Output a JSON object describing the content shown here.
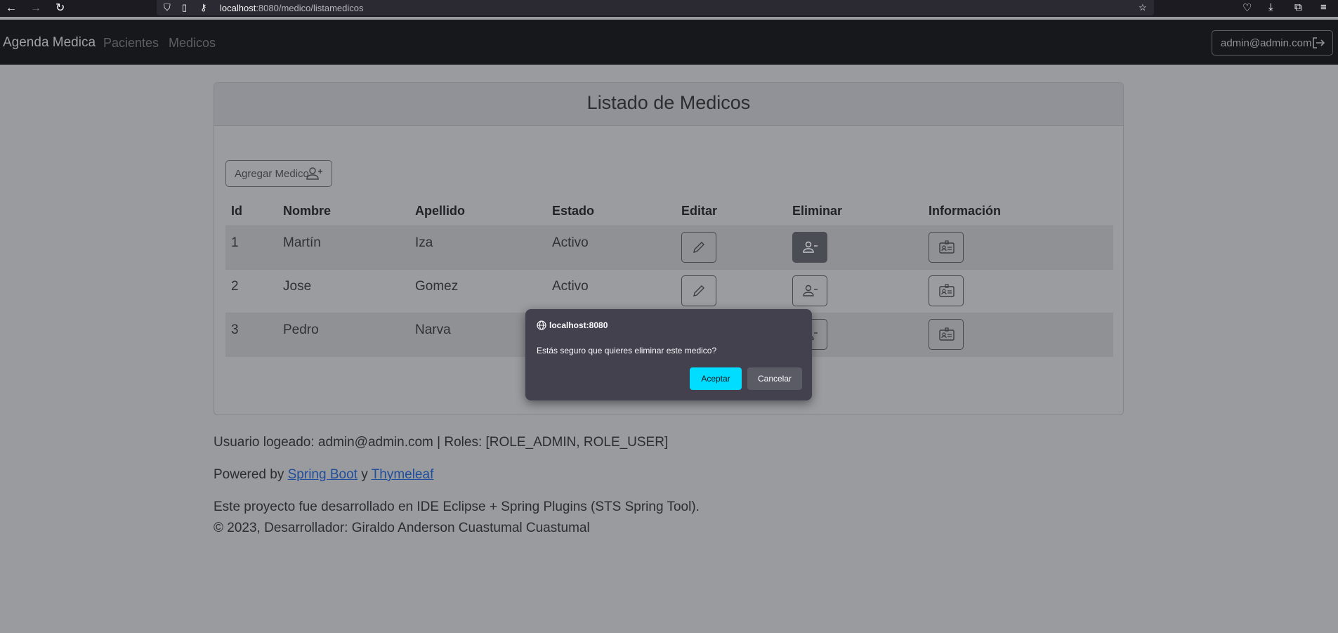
{
  "browser": {
    "url_host": "localhost",
    "url_rest": ":8080/medico/listamedicos"
  },
  "navbar": {
    "brand": "Agenda Medica",
    "links": [
      "Pacientes",
      "Medicos"
    ],
    "user": "admin@admin.com"
  },
  "card": {
    "title": "Listado de Medicos",
    "add_button": "Agregar Medico"
  },
  "table": {
    "headers": [
      "Id",
      "Nombre",
      "Apellido",
      "Estado",
      "Editar",
      "Eliminar",
      "Información"
    ],
    "rows": [
      {
        "id": "1",
        "nombre": "Martín",
        "apellido": "Iza",
        "estado": "Activo"
      },
      {
        "id": "2",
        "nombre": "Jose",
        "apellido": "Gomez",
        "estado": "Activo"
      },
      {
        "id": "3",
        "nombre": "Pedro",
        "apellido": "Narva",
        "estado": ""
      }
    ]
  },
  "footer": {
    "user_line": "Usuario logeado: admin@admin.com | Roles: [ROLE_ADMIN, ROLE_USER]",
    "powered_prefix": "Powered by ",
    "spring_link": "Spring Boot",
    "and": " y ",
    "thymeleaf_link": "Thymeleaf",
    "project_line": "Este proyecto fue desarrollado en IDE Eclipse + Spring Plugins (STS Spring Tool).",
    "copyright": "© 2023, Desarrollador: Giraldo Anderson Cuastumal Cuastumal"
  },
  "dialog": {
    "origin": "localhost:8080",
    "message": "Estás seguro que quieres eliminar este medico?",
    "ok": "Aceptar",
    "cancel": "Cancelar"
  }
}
